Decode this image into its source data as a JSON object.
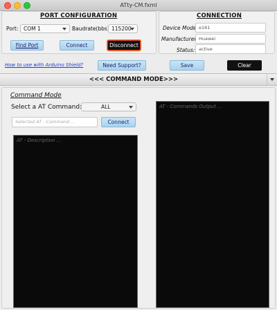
{
  "window": {
    "title": "ATty-CM.fxml"
  },
  "port_config": {
    "title": "PORT CONFIGURATION",
    "port_label": "Port:",
    "port_value": "COM 1",
    "baud_label": "Baudrate(bbs):",
    "baud_value": "115200",
    "find_port_label": "Find Port",
    "connect_label": "Connect",
    "disconnect_label": "Disconnect"
  },
  "connection": {
    "title": "CONNECTION",
    "device_model_label": "Device Model:",
    "device_model_value": "e161",
    "manufacturer_label": "Manufacturer:",
    "manufacturer_value": "Huawei",
    "status_label": "Status:",
    "status_value": "active"
  },
  "toolbar": {
    "help_link": "How to use with Arduino Shield?",
    "support_label": "Need Support?",
    "save_label": "Save",
    "clear_label": "Clear"
  },
  "mode_bar": {
    "label": "<<< COMMAND MODE>>>"
  },
  "command_mode": {
    "title": "Command  Mode",
    "select_label": "Select a AT Command:",
    "filter_value": "ALL",
    "command_placeholder": "Selected AT - Command ...",
    "connect_label": "Connect",
    "description_placeholder": "AT - Description ...",
    "output_placeholder": "AT - Commands Output ..."
  },
  "icons": {
    "window_close": "close-dot-icon",
    "window_minimize": "minimize-dot-icon",
    "window_maximize": "maximize-dot-icon",
    "dropdown": "chevron-down-icon"
  },
  "colors": {
    "button_blue": "#b7dcf1",
    "button_dark": "#111111",
    "disconnect_border": "#ff6a3a",
    "link": "#1a3fd0",
    "console_bg": "#0a0a0a"
  }
}
